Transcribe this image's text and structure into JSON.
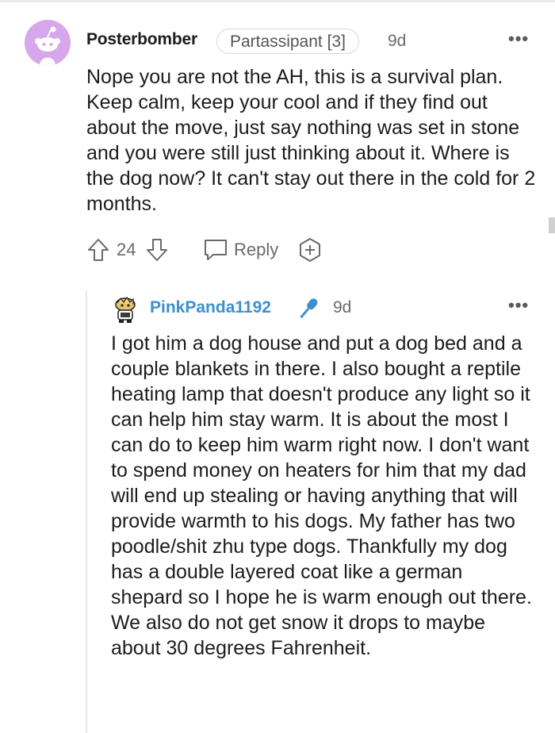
{
  "parent": {
    "username": "Posterbomber",
    "flair": "Partassipant [3]",
    "time": "9d",
    "more": "•••",
    "body": "Nope you are not the AH, this is a survival plan. Keep calm, keep your cool and if they find out about the move, just say nothing was set in stone and you were still just thinking about it. Where is the dog now? It can't stay out there in the cold for 2 months.",
    "votes": "24",
    "reply_label": "Reply"
  },
  "reply": {
    "username": "PinkPanda1192",
    "time": "9d",
    "more": "•••",
    "body": "I got him a dog house and put a dog bed and a couple blankets in there. I also bought a reptile heating lamp that doesn't produce any light so it can help him stay warm. It is about the most I can do to keep him warm right now. I don't want to spend money on heaters for him that my dad will end up stealing or having anything that will provide warmth to his dogs. My father has two poodle/shit zhu type dogs. Thankfully my dog has a double layered coat like a german shepard so I hope he is warm enough out there. We also do not get snow it drops to maybe about 30 degrees Fahrenheit."
  },
  "icons": {
    "parent_avatar": "reddit-snoo-avatar-icon",
    "reply_avatar": "snoo-avatar-icon",
    "op_badge": "microphone-icon",
    "upvote": "arrow-up-icon",
    "downvote": "arrow-down-icon",
    "reply": "speech-bubble-icon",
    "award": "award-plus-icon"
  },
  "colors": {
    "avatar_bg": "#d7a7ec",
    "op_username": "#3b8fd0",
    "muted": "#6a6a6a"
  }
}
